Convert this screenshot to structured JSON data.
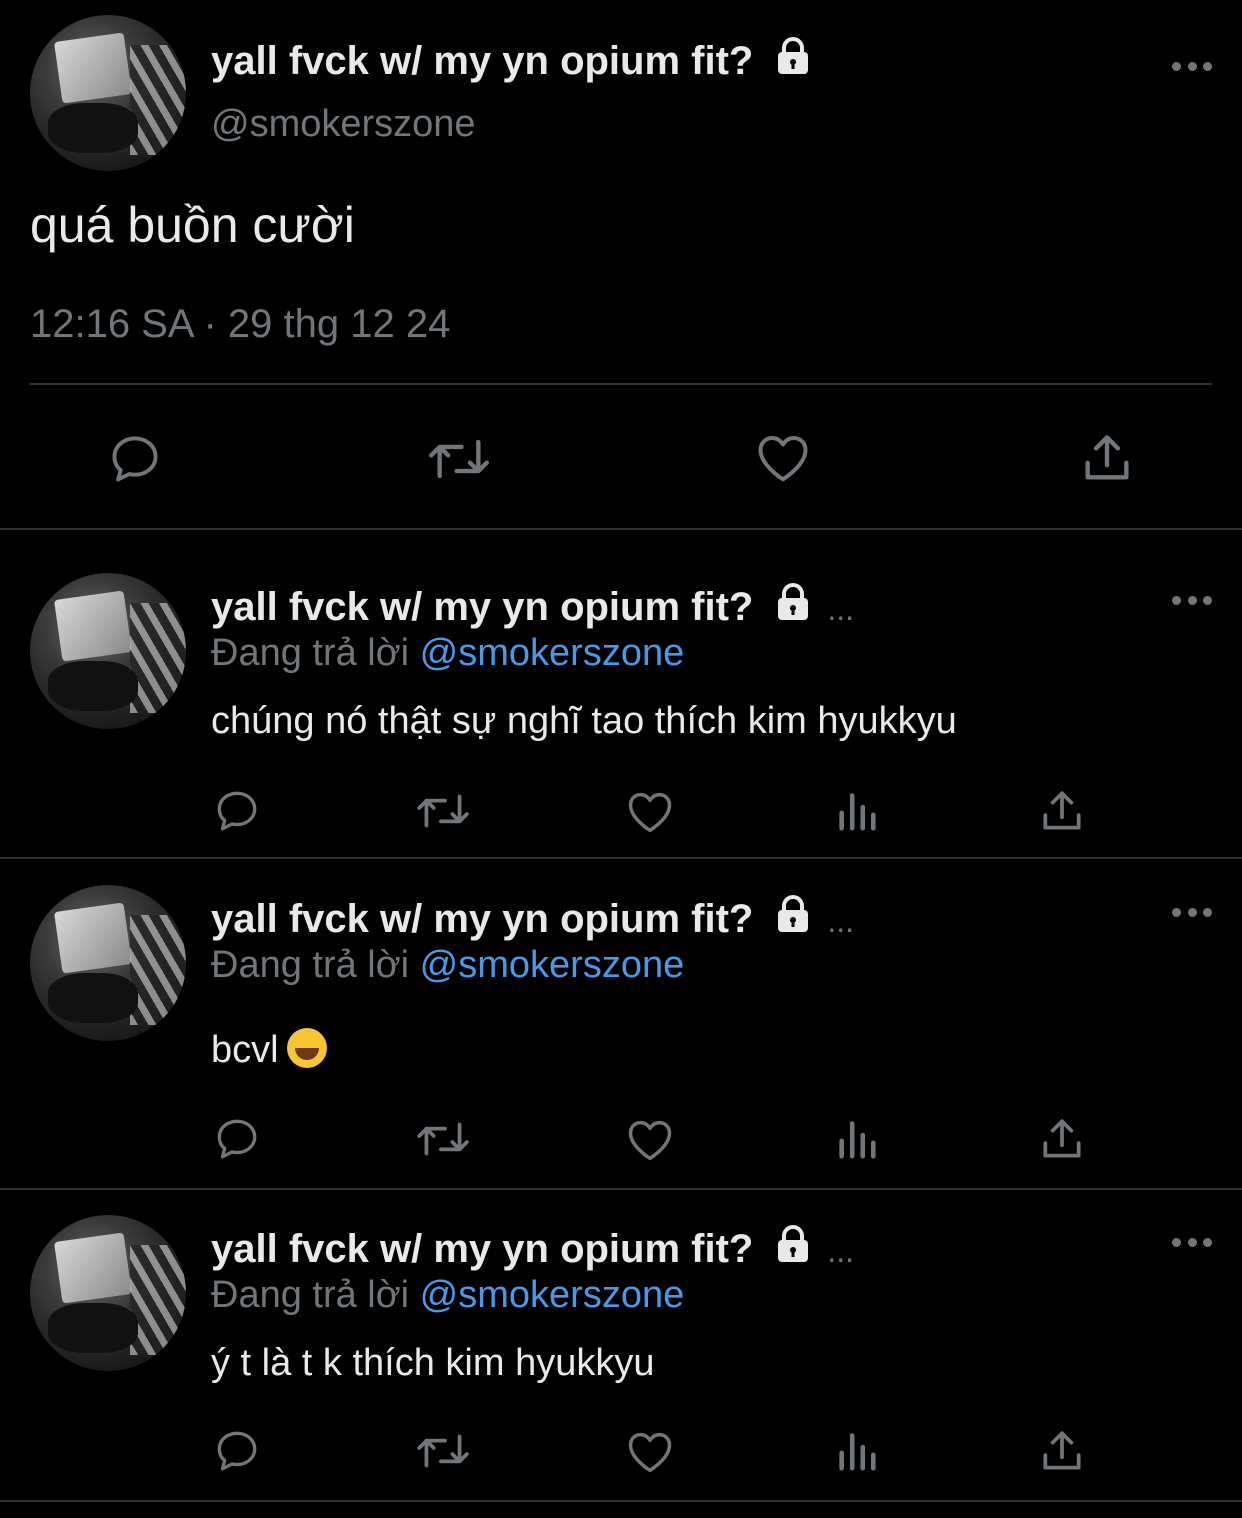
{
  "main": {
    "display_name": "yall fvck w/ my yn opium fit?",
    "handle": "@smokerszone",
    "text": "quá buồn cười",
    "timestamp": "12:16 SA · 29 thg 12 24",
    "actions": [
      "reply-icon",
      "retweet-icon",
      "like-icon",
      "share-icon"
    ]
  },
  "replies": [
    {
      "display_name": "yall fvck w/ my yn opium fit?",
      "ellipsis": "...",
      "replying_label": "Đang trả lời",
      "mention": "@smokerszone",
      "text": "chúng nó thật sự nghĩ tao thích kim hyukkyu",
      "emoji": ""
    },
    {
      "display_name": "yall fvck w/ my yn opium fit?",
      "ellipsis": "...",
      "replying_label": "Đang trả lời",
      "mention": "@smokerszone",
      "text": "bcvl",
      "emoji": "😂"
    },
    {
      "display_name": "yall fvck w/ my yn opium fit?",
      "ellipsis": "...",
      "replying_label": "Đang trả lời",
      "mention": "@smokerszone",
      "text": "ý t là t k thích kim hyukkyu",
      "emoji": ""
    }
  ],
  "colors": {
    "background": "#000000",
    "text": "#e7e9ea",
    "muted": "#71767b",
    "mention": "#4a99e9",
    "divider": "#2f3336"
  }
}
